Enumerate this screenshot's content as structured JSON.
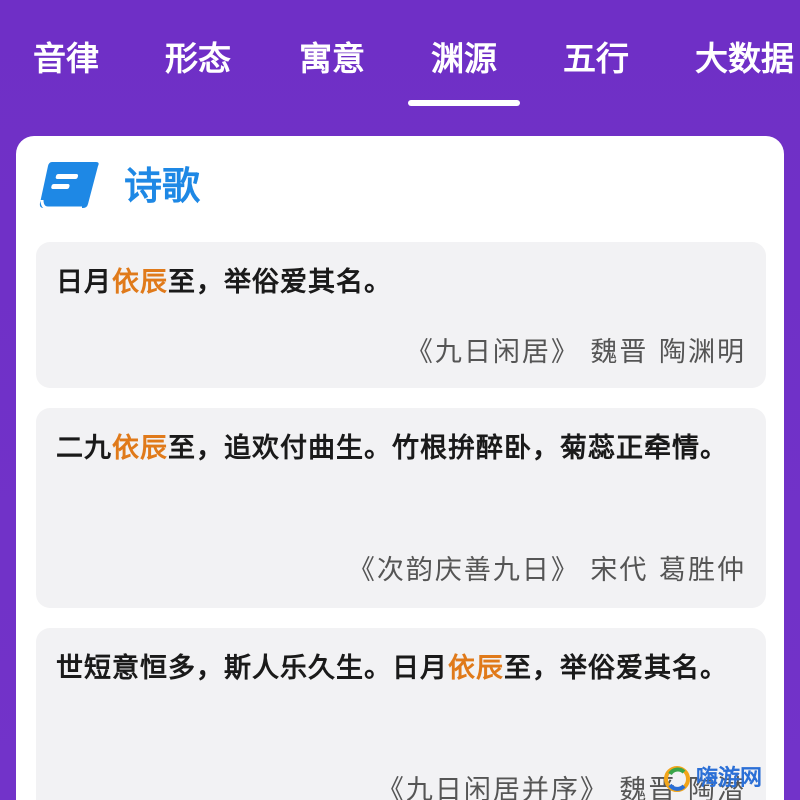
{
  "tabs": [
    {
      "label": "音律"
    },
    {
      "label": "形态"
    },
    {
      "label": "寓意"
    },
    {
      "label": "渊源",
      "active": true
    },
    {
      "label": "五行"
    },
    {
      "label": "大数据"
    }
  ],
  "section": {
    "icon": "book-icon",
    "title": "诗歌"
  },
  "highlight_color": "#e07a1a",
  "title_color": "#1e88e5",
  "poems": [
    {
      "verse_before": "日月",
      "verse_highlight": "依辰",
      "verse_after": "至，举俗爱其名。",
      "source": "《九日闲居》 魏晋 陶渊明"
    },
    {
      "verse_before": "二九",
      "verse_highlight": "依辰",
      "verse_after": "至，追欢付曲生。竹根拚醉卧，菊蕊正牵情。",
      "source": "《次韵庆善九日》 宋代 葛胜仲"
    },
    {
      "verse_before": "世短意恒多，斯人乐久生。日月",
      "verse_highlight": "依辰",
      "verse_after": "至，举俗爱其名。",
      "source": "《九日闲居并序》 魏晋 陶潜"
    }
  ],
  "watermark": {
    "text": "嗨游网"
  }
}
